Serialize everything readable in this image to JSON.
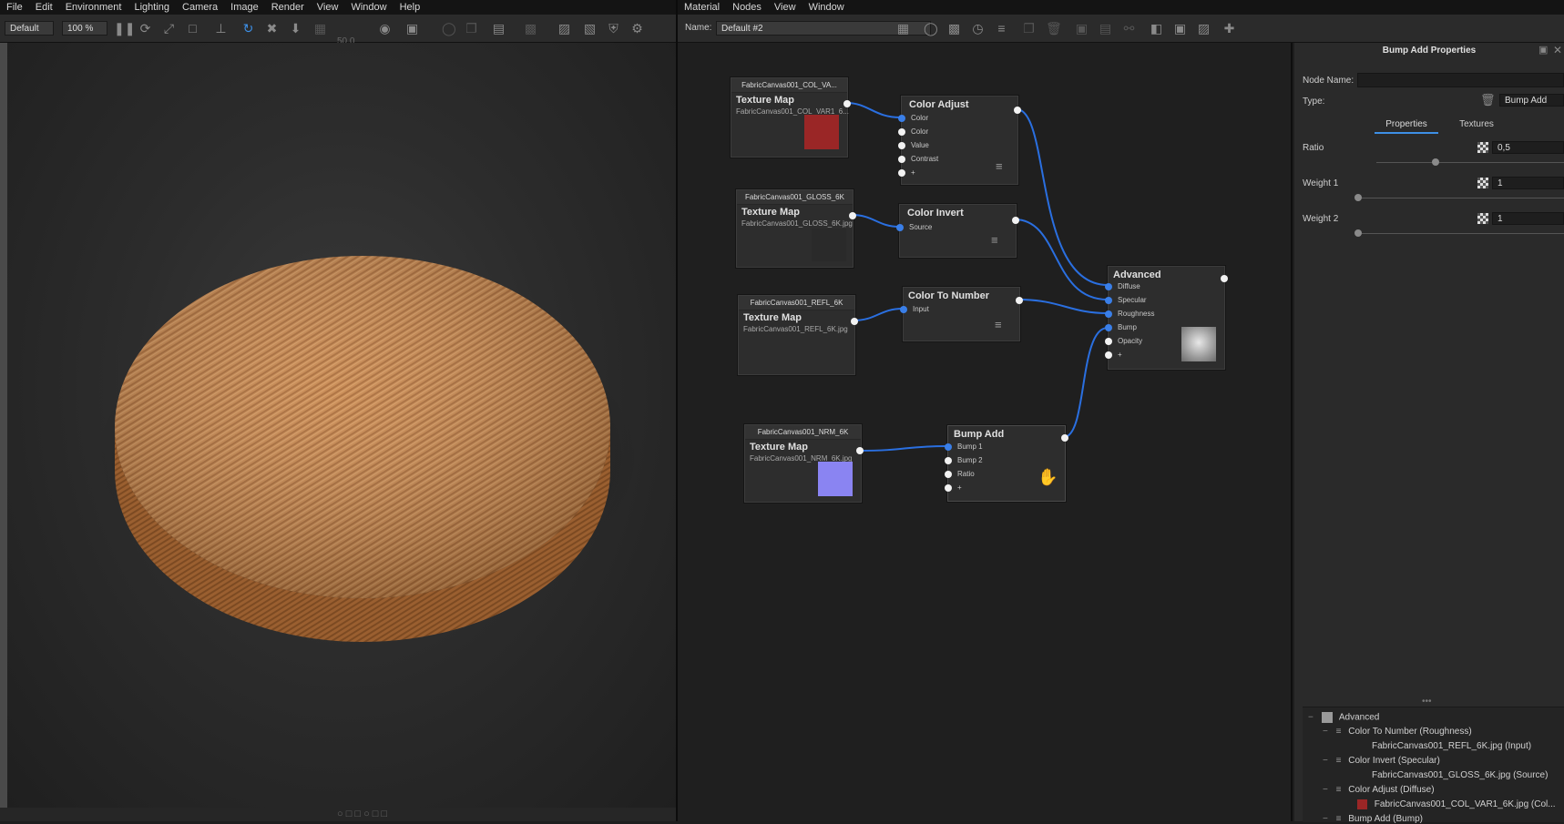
{
  "left_menu": [
    "File",
    "Edit",
    "Environment",
    "Lighting",
    "Camera",
    "Image",
    "Render",
    "View",
    "Window",
    "Help"
  ],
  "right_menu": [
    "Material",
    "Nodes",
    "View",
    "Window"
  ],
  "left_toolbar": {
    "preset": "Default",
    "zoom": "100 %",
    "value": "50,0"
  },
  "node_toolbar": {
    "name_label": "Name:",
    "name_value": "Default #2"
  },
  "nodes": {
    "tex1": {
      "header": "FabricCanvas001_COL_VA...",
      "title": "Texture Map",
      "file": "FabricCanvas001_COL_VAR1_6...",
      "swatch": "#9a2626"
    },
    "tex2": {
      "header": "FabricCanvas001_GLOSS_6K",
      "title": "Texture Map",
      "file": "FabricCanvas001_GLOSS_6K.jpg"
    },
    "tex3": {
      "header": "FabricCanvas001_REFL_6K",
      "title": "Texture Map",
      "file": "FabricCanvas001_REFL_6K.jpg"
    },
    "tex4": {
      "header": "FabricCanvas001_NRM_6K",
      "title": "Texture Map",
      "file": "FabricCanvas001_NRM_6K.jpg",
      "swatch": "#8a84f2"
    },
    "color_adjust": {
      "title": "Color Adjust",
      "ports": [
        "Color",
        "Color",
        "Value",
        "Contrast",
        "+"
      ]
    },
    "color_invert": {
      "title": "Color Invert",
      "ports": [
        "Source"
      ]
    },
    "color_to_number": {
      "title": "Color To Number",
      "ports": [
        "Input"
      ]
    },
    "bump_add": {
      "title": "Bump Add",
      "ports": [
        "Bump 1",
        "Bump 2",
        "Ratio",
        "+"
      ]
    },
    "advanced": {
      "title": "Advanced",
      "ports": [
        "Diffuse",
        "Specular",
        "Roughness",
        "Bump",
        "Opacity",
        "+"
      ]
    }
  },
  "properties": {
    "panel_title": "Bump Add Properties",
    "node_name_label": "Node Name:",
    "node_name_value": "",
    "type_label": "Type:",
    "type_value": "Bump Add",
    "tabs": [
      "Properties",
      "Textures"
    ],
    "ratio_label": "Ratio",
    "ratio_value": "0,5",
    "weight1_label": "Weight 1",
    "weight1_value": "1",
    "weight2_label": "Weight 2",
    "weight2_value": "1"
  },
  "tree": [
    "Advanced",
    "Color To Number (Roughness)",
    "FabricCanvas001_REFL_6K.jpg (Input)",
    "Color Invert (Specular)",
    "FabricCanvas001_GLOSS_6K.jpg (Source)",
    "Color Adjust (Diffuse)",
    "FabricCanvas001_COL_VAR1_6K.jpg (Col...",
    "Bump Add (Bump)"
  ],
  "colors": {
    "accent": "#3d8fe6",
    "wire": "#2a6fe0",
    "cloth": "#c4844a"
  }
}
